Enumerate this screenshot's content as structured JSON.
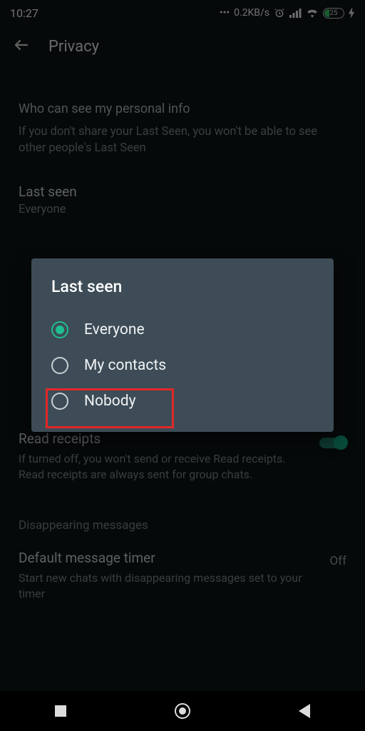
{
  "statusbar": {
    "time": "10:27",
    "data_speed": "0.2KB/s",
    "battery_pct": "25"
  },
  "appbar": {
    "title": "Privacy"
  },
  "sections": {
    "personal_info_heading": "Who can see my personal info",
    "personal_info_sub": "If you don't share your Last Seen, you won't be able to see other people's Last Seen",
    "last_seen_title": "Last seen",
    "last_seen_value": "Everyone",
    "read_receipts_title": "Read receipts",
    "read_receipts_desc": "If turned off, you won't send or receive Read receipts. Read receipts are always sent for group chats.",
    "disappearing_label": "Disappearing messages",
    "timer_title": "Default message timer",
    "timer_desc": "Start new chats with disappearing messages set to your timer",
    "timer_value": "Off"
  },
  "dialog": {
    "title": "Last seen",
    "options": [
      {
        "label": "Everyone",
        "selected": true
      },
      {
        "label": "My contacts",
        "selected": false
      },
      {
        "label": "Nobody",
        "selected": false
      }
    ]
  },
  "colors": {
    "accent": "#1fbf8f",
    "dialog_bg": "#3d4c56",
    "highlight": "#e22828"
  }
}
